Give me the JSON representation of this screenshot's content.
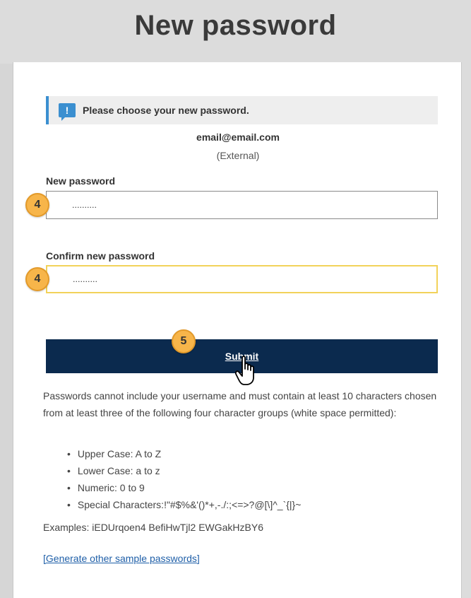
{
  "header": {
    "title": "New password"
  },
  "notice": {
    "text": "Please choose your new password.",
    "icon": "info-icon"
  },
  "account": {
    "email": "email@email.com",
    "type": "(External)"
  },
  "fields": {
    "new_password": {
      "label": "New password",
      "value": "..........",
      "step": "4"
    },
    "confirm_password": {
      "label": "Confirm new password",
      "value": "..........",
      "step": "4"
    }
  },
  "submit": {
    "label": "Submit",
    "step": "5"
  },
  "help": {
    "text": "Passwords cannot include your username and must contain at least 10 characters chosen from at least three of the following four character groups (white space permitted):",
    "rules": [
      "Upper Case: A to Z",
      "Lower Case: a to z",
      "Numeric: 0 to 9",
      "Special Characters:!\"#$%&'()*+,-./:;<=>?@[\\]^_`{|}~"
    ],
    "examples": "Examples: iEDUrqoen4 BefiHwTjl2 EWGakHzBY6",
    "generate_link": "[Generate other sample passwords]"
  },
  "colors": {
    "accent": "#3b8fd0",
    "submit_bg": "#0b2a4e",
    "step_badge": "#f7b54a",
    "focus_border": "#f2d25a",
    "link": "#1f5fa8"
  }
}
